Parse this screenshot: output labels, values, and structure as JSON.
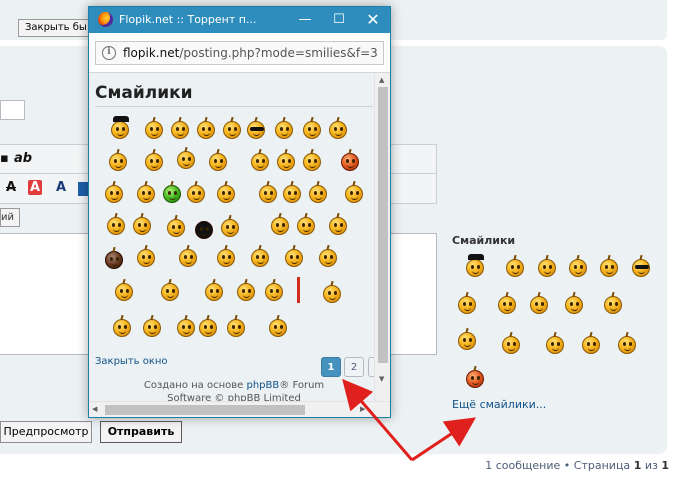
{
  "background": {
    "close_button_label": "Закрыть бы",
    "toolbar_bold_label": "ab",
    "toolbar_letter_a": "A",
    "ij_button_label": "ий",
    "preview_button": "Предпросмотр",
    "submit_button": "Отправить",
    "sidebar": {
      "title": "Смайлики",
      "more_link": "Ещё смайлики..."
    },
    "pagination": {
      "messages": "1 сообщение",
      "separator": "•",
      "page_word": "Страница",
      "current": "1",
      "of_word": "из",
      "total": "1"
    }
  },
  "popup": {
    "window_title": "Flopik.net :: Торрент п...",
    "url_domain": "flopik.net",
    "url_path": "/posting.php?mode=smilies&f=3",
    "heading": "Смайлики",
    "close_link": "Закрыть окно",
    "pages": [
      "1",
      "2"
    ],
    "footer_line1_prefix": "Создано на основе",
    "footer_link": "phpBB",
    "footer_line1_suffix": "® Forum",
    "footer_line2": "Software © phpBB Limited"
  },
  "icons": {
    "window_minimize": "minimize-icon",
    "window_maximize": "maximize-icon",
    "window_close": "close-icon",
    "browser": "firefox-icon",
    "site_info": "info-icon"
  },
  "colors": {
    "titlebar": "#2f8dbd",
    "panel_bg": "#ecf1f3",
    "link": "#105289",
    "active_page": "#4692bf",
    "arrow": "#e0201c"
  }
}
